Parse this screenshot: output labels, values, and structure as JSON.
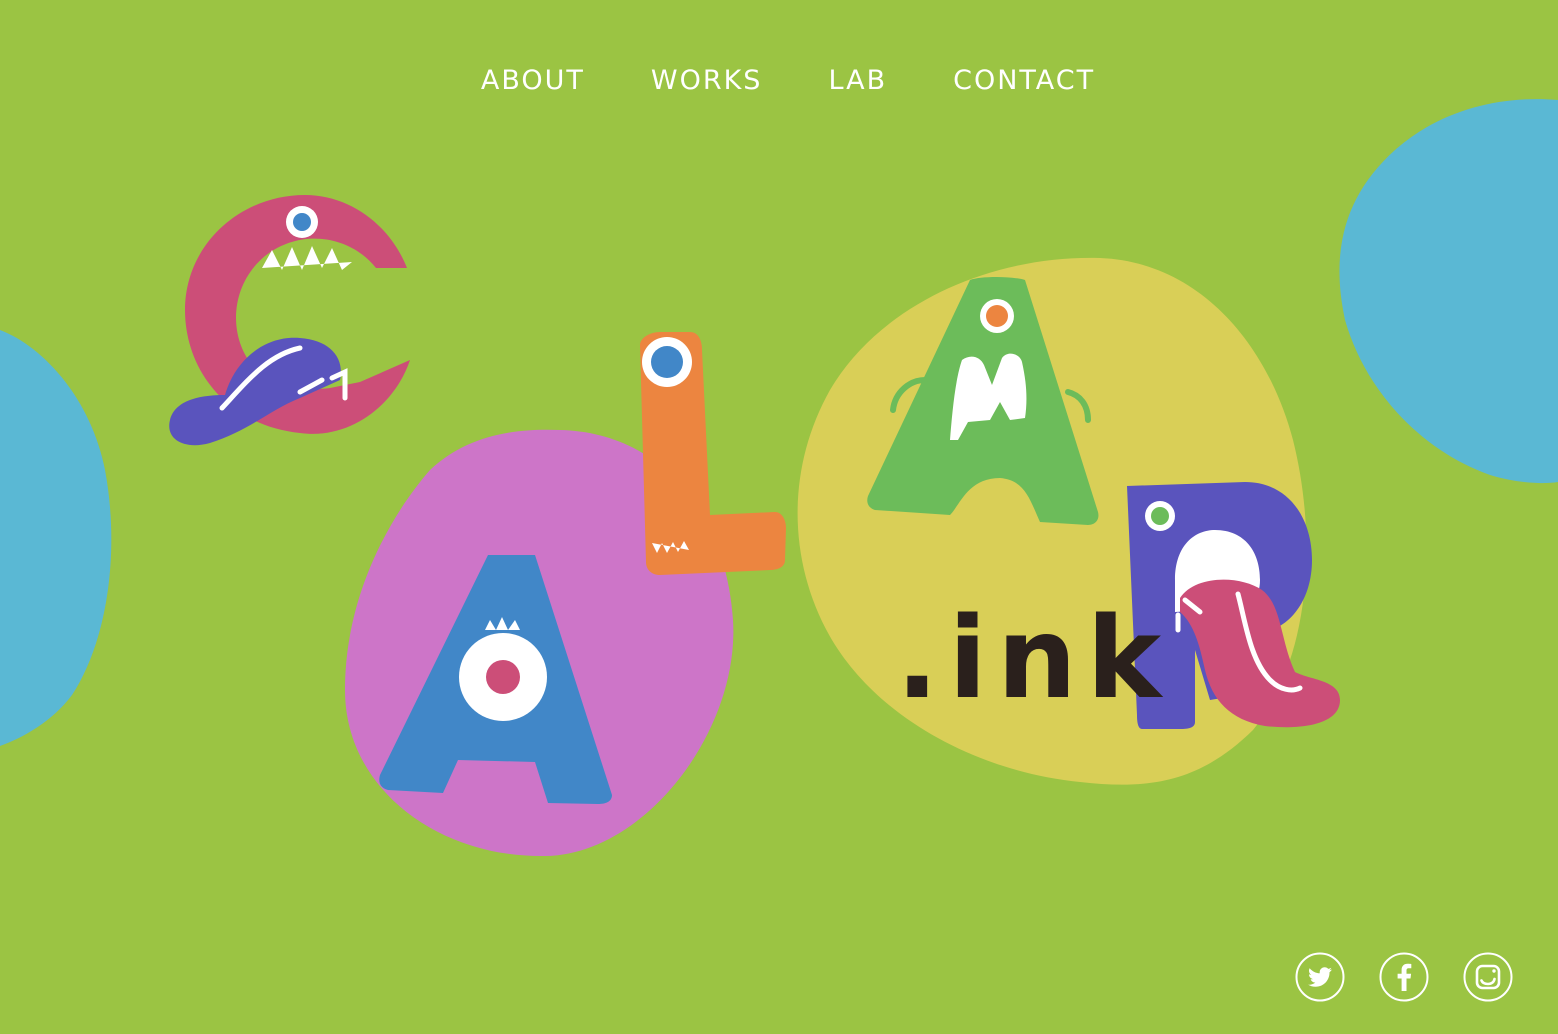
{
  "nav": {
    "items": [
      {
        "label": "ABOUT"
      },
      {
        "label": "WORKS"
      },
      {
        "label": "LAB"
      },
      {
        "label": "CONTACT"
      }
    ]
  },
  "logo": {
    "letters": [
      "C",
      "A",
      "L",
      "A",
      "R"
    ],
    "suffix": ".ink"
  },
  "social": [
    {
      "icon": "twitter-icon"
    },
    {
      "icon": "facebook-icon"
    },
    {
      "icon": "instagram-icon"
    }
  ],
  "colors": {
    "background": "#9bc443",
    "blob_blue": "#5ab8d4",
    "blob_pink": "#cd75c8",
    "blob_yellow": "#d9cf57",
    "letter_c": "#cc4e78",
    "letter_a_blue": "#4187c8",
    "letter_l": "#ec8540",
    "letter_a_green": "#6cbc5a",
    "letter_r": "#5a54bd",
    "tongue_purple": "#5a54bd",
    "tongue_pink": "#cc4e78",
    "suffix_text": "#2a201c"
  }
}
